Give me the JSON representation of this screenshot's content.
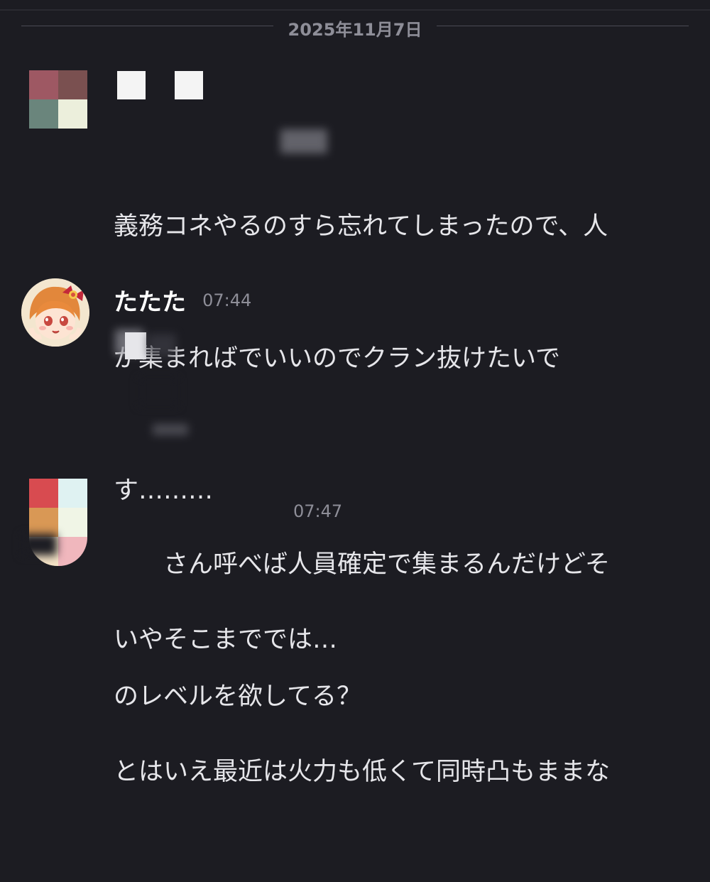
{
  "date_separator": "2025年11月7日",
  "messages": [
    {
      "username": "",
      "timestamp": "",
      "avatar_colors": [
        "#9e5863",
        "#7a5050",
        "#6a857c",
        "#ecefdc"
      ],
      "lines": [
        "義務コネやるのすら忘れてしまったので、人",
        "が集まればでいいのでクラン抜けたいで",
        "す………"
      ]
    },
    {
      "username": "たたた",
      "timestamp": "07:44",
      "lines": [
        "",
        "　　さん呼べば人員確定で集まるんだけどそ",
        "のレベルを欲してる？"
      ]
    },
    {
      "username": "",
      "timestamp": "07:47",
      "avatar_colors": [
        "#d84b50",
        "#dff2f2",
        "#d99855",
        "#f0f5e6",
        "#f4e3c6",
        "#f0b7bd"
      ],
      "lines": [
        "いやそこまででは…",
        "とはいえ最近は火力も低くて同時凸もままな"
      ]
    }
  ]
}
